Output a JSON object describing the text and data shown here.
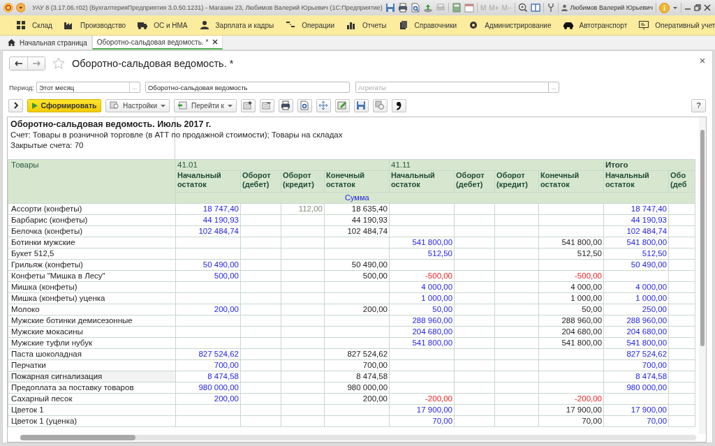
{
  "window": {
    "title": "УАУ 8 (3.17.06.т02) (БухгалтерияПредприятия 3.0.50.1231) - Магазин 23, Любимов Валерий Юрьевич  (1С:Предприятие)",
    "memory_keys": [
      "M",
      "M+",
      "M−"
    ],
    "user": "Любимов Валерий Юрьевич"
  },
  "sections": [
    "Склад",
    "Производство",
    "ОС и НМА",
    "Зарплата и кадры",
    "Операции",
    "Отчеты",
    "Справочники",
    "Администрирование",
    "Автотранспорт",
    "Оперативный учет"
  ],
  "tabs": [
    {
      "label": "Начальная страница",
      "selected": false
    },
    {
      "label": "Оборотно-сальдовая ведомость. *",
      "selected": true
    }
  ],
  "form": {
    "title": "Оборотно-сальдовая ведомость. *",
    "period": {
      "label": "Период:",
      "value": "Этот месяц",
      "button": "..."
    },
    "report_kind": {
      "value": "Оборотно-сальдовая ведомость"
    },
    "aggregates": {
      "placeholder": "Агрегаты",
      "button": "..."
    },
    "toolbar": {
      "generate": "Сформировать",
      "settings": "Настройки",
      "goto": "Перейти к",
      "help": "?"
    }
  },
  "report": {
    "title": "Оборотно-сальдовая ведомость. Июль 2017 г.",
    "lines": [
      "Счет: Товары в розничной торговле (в АТТ по продажной стоимости); Товары на складах",
      "Закрытые счета: 70"
    ],
    "corner": "Товары",
    "groups": [
      {
        "label": "41.01"
      },
      {
        "label": "41.11"
      },
      {
        "label": "Итого"
      }
    ],
    "columns": [
      "Начальный остаток",
      "Оборот (дебет)",
      "Оборот (кредит)",
      "Конечный остаток",
      "Начальный остаток",
      "Оборот (дебет)",
      "Оборот (кредит)",
      "Конечный остаток",
      "Начальный остаток",
      "Обо (деб"
    ],
    "unit": "Сумма",
    "rows": [
      {
        "name": "Ассорти (конфеты)",
        "selected": false,
        "cells": [
          {
            "t": "18 747,40",
            "kind": "link"
          },
          null,
          {
            "t": "112,00",
            "kind": "muted"
          },
          {
            "t": "18 635,40",
            "kind": "plain"
          },
          null,
          null,
          null,
          null,
          {
            "t": "18 747,40",
            "kind": "link"
          }
        ]
      },
      {
        "name": "Барбарис (конфеты)",
        "selected": false,
        "cells": [
          {
            "t": "44 190,93",
            "kind": "link"
          },
          null,
          null,
          {
            "t": "44 190,93",
            "kind": "plain"
          },
          null,
          null,
          null,
          null,
          {
            "t": "44 190,93",
            "kind": "link"
          }
        ]
      },
      {
        "name": "Белочка (конфеты)",
        "selected": false,
        "cells": [
          {
            "t": "102 484,74",
            "kind": "link"
          },
          null,
          null,
          {
            "t": "102 484,74",
            "kind": "plain"
          },
          null,
          null,
          null,
          null,
          {
            "t": "102 484,74",
            "kind": "link"
          }
        ]
      },
      {
        "name": "Ботинки мужские",
        "selected": false,
        "cells": [
          null,
          null,
          null,
          null,
          {
            "t": "541 800,00",
            "kind": "link"
          },
          null,
          null,
          {
            "t": "541 800,00",
            "kind": "plain"
          },
          {
            "t": "541 800,00",
            "kind": "link"
          }
        ]
      },
      {
        "name": "Букет 512,5",
        "selected": false,
        "cells": [
          null,
          null,
          null,
          null,
          {
            "t": "512,50",
            "kind": "link"
          },
          null,
          null,
          {
            "t": "512,50",
            "kind": "plain"
          },
          {
            "t": "512,50",
            "kind": "link"
          }
        ]
      },
      {
        "name": "Грильяж (конфеты)",
        "selected": false,
        "cells": [
          {
            "t": "50 490,00",
            "kind": "link"
          },
          null,
          null,
          {
            "t": "50 490,00",
            "kind": "plain"
          },
          null,
          null,
          null,
          null,
          {
            "t": "50 490,00",
            "kind": "link"
          }
        ]
      },
      {
        "name": "Конфеты \"Мишка в Лесу\"",
        "selected": false,
        "cells": [
          {
            "t": "500,00",
            "kind": "link"
          },
          null,
          null,
          {
            "t": "500,00",
            "kind": "plain"
          },
          {
            "t": "-500,00",
            "kind": "negative"
          },
          null,
          null,
          {
            "t": "-500,00",
            "kind": "negative"
          },
          null
        ]
      },
      {
        "name": "Мишка (конфеты)",
        "selected": false,
        "cells": [
          null,
          null,
          null,
          null,
          {
            "t": "4 000,00",
            "kind": "link"
          },
          null,
          null,
          {
            "t": "4 000,00",
            "kind": "plain"
          },
          {
            "t": "4 000,00",
            "kind": "link"
          }
        ]
      },
      {
        "name": "Мишка (конфеты) уценка",
        "selected": false,
        "cells": [
          null,
          null,
          null,
          null,
          {
            "t": "1 000,00",
            "kind": "link"
          },
          null,
          null,
          {
            "t": "1 000,00",
            "kind": "plain"
          },
          {
            "t": "1 000,00",
            "kind": "link"
          }
        ]
      },
      {
        "name": "Молоко",
        "selected": false,
        "cells": [
          {
            "t": "200,00",
            "kind": "link"
          },
          null,
          null,
          {
            "t": "200,00",
            "kind": "plain"
          },
          {
            "t": "50,00",
            "kind": "link"
          },
          null,
          null,
          {
            "t": "50,00",
            "kind": "plain"
          },
          {
            "t": "250,00",
            "kind": "link"
          }
        ]
      },
      {
        "name": "Мужские ботинки демисезонные",
        "selected": false,
        "cells": [
          null,
          null,
          null,
          null,
          {
            "t": "288 960,00",
            "kind": "link"
          },
          null,
          null,
          {
            "t": "288 960,00",
            "kind": "plain"
          },
          {
            "t": "288 960,00",
            "kind": "link"
          }
        ]
      },
      {
        "name": "Мужские мокасины",
        "selected": false,
        "cells": [
          null,
          null,
          null,
          null,
          {
            "t": "204 680,00",
            "kind": "link"
          },
          null,
          null,
          {
            "t": "204 680,00",
            "kind": "plain"
          },
          {
            "t": "204 680,00",
            "kind": "link"
          }
        ]
      },
      {
        "name": "Мужские туфли нубук",
        "selected": false,
        "cells": [
          null,
          null,
          null,
          null,
          {
            "t": "541 800,00",
            "kind": "link"
          },
          null,
          null,
          {
            "t": "541 800,00",
            "kind": "plain"
          },
          {
            "t": "541 800,00",
            "kind": "link"
          }
        ]
      },
      {
        "name": "Паста шоколадная",
        "selected": false,
        "cells": [
          {
            "t": "827 524,62",
            "kind": "link"
          },
          null,
          null,
          {
            "t": "827 524,62",
            "kind": "plain"
          },
          null,
          null,
          null,
          null,
          {
            "t": "827 524,62",
            "kind": "link"
          }
        ]
      },
      {
        "name": "Перчатки",
        "selected": false,
        "cells": [
          {
            "t": "700,00",
            "kind": "link"
          },
          null,
          null,
          {
            "t": "700,00",
            "kind": "plain"
          },
          null,
          null,
          null,
          null,
          {
            "t": "700,00",
            "kind": "link"
          }
        ]
      },
      {
        "name": "Пожарная сигнализация",
        "selected": true,
        "cells": [
          {
            "t": "8 474,58",
            "kind": "link"
          },
          null,
          null,
          {
            "t": "8 474,58",
            "kind": "plain"
          },
          null,
          null,
          null,
          null,
          {
            "t": "8 474,58",
            "kind": "link"
          }
        ]
      },
      {
        "name": "Предоплата за поставку товаров",
        "selected": false,
        "cells": [
          {
            "t": "980 000,00",
            "kind": "link"
          },
          null,
          null,
          {
            "t": "980 000,00",
            "kind": "plain"
          },
          null,
          null,
          null,
          null,
          {
            "t": "980 000,00",
            "kind": "link"
          }
        ]
      },
      {
        "name": "Сахарный песок",
        "selected": false,
        "cells": [
          {
            "t": "200,00",
            "kind": "link"
          },
          null,
          null,
          {
            "t": "200,00",
            "kind": "plain"
          },
          {
            "t": "-200,00",
            "kind": "negative"
          },
          null,
          null,
          {
            "t": "-200,00",
            "kind": "negative"
          },
          null
        ]
      },
      {
        "name": "Цветок 1",
        "selected": false,
        "cells": [
          null,
          null,
          null,
          null,
          {
            "t": "17 900,00",
            "kind": "link"
          },
          null,
          null,
          {
            "t": "17 900,00",
            "kind": "plain"
          },
          {
            "t": "17 900,00",
            "kind": "link"
          }
        ]
      },
      {
        "name": "Цветок 1 (уценка)",
        "selected": false,
        "cells": [
          null,
          null,
          null,
          null,
          {
            "t": "70,00",
            "kind": "link"
          },
          null,
          null,
          {
            "t": "70,00",
            "kind": "plain"
          },
          {
            "t": "70,00",
            "kind": "link"
          }
        ]
      }
    ]
  }
}
